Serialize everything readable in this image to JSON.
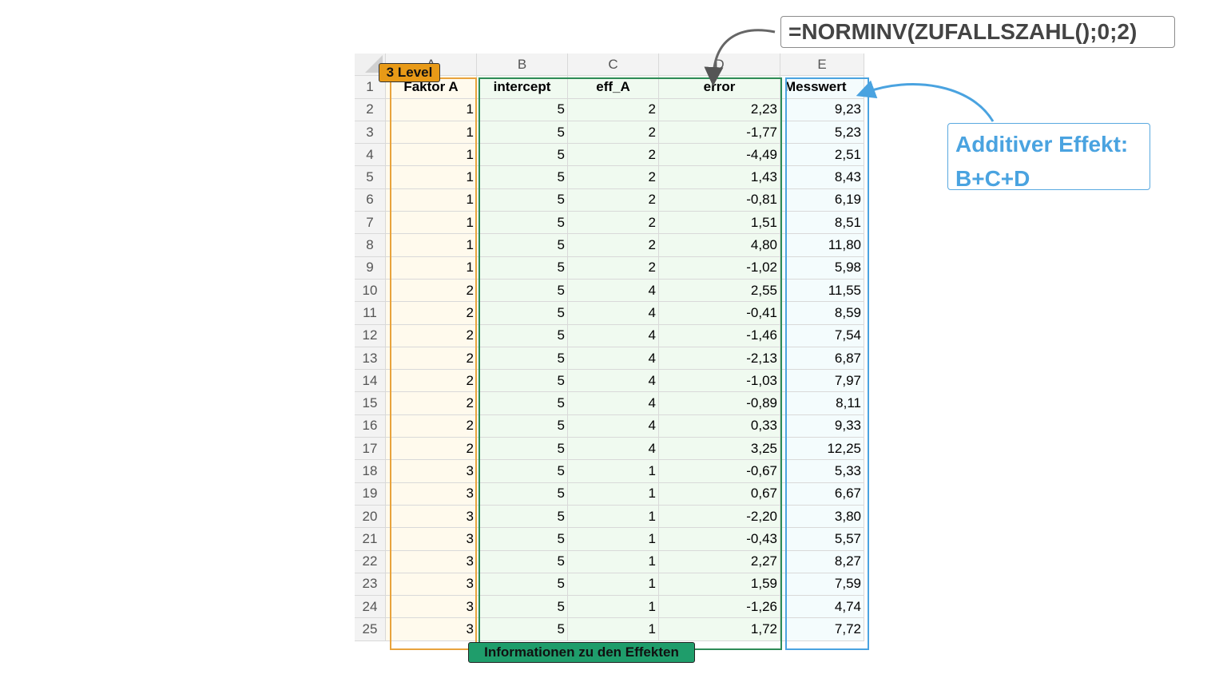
{
  "sheet": {
    "column_letters": [
      "A",
      "B",
      "C",
      "D",
      "E"
    ],
    "headers": [
      "Faktor A",
      "intercept",
      "eff_A",
      "error",
      "Messwert"
    ],
    "rows": [
      {
        "n": "2",
        "a": "1",
        "b": "5",
        "c": "2",
        "d": "2,23",
        "e": "9,23"
      },
      {
        "n": "3",
        "a": "1",
        "b": "5",
        "c": "2",
        "d": "-1,77",
        "e": "5,23"
      },
      {
        "n": "4",
        "a": "1",
        "b": "5",
        "c": "2",
        "d": "-4,49",
        "e": "2,51"
      },
      {
        "n": "5",
        "a": "1",
        "b": "5",
        "c": "2",
        "d": "1,43",
        "e": "8,43"
      },
      {
        "n": "6",
        "a": "1",
        "b": "5",
        "c": "2",
        "d": "-0,81",
        "e": "6,19"
      },
      {
        "n": "7",
        "a": "1",
        "b": "5",
        "c": "2",
        "d": "1,51",
        "e": "8,51"
      },
      {
        "n": "8",
        "a": "1",
        "b": "5",
        "c": "2",
        "d": "4,80",
        "e": "11,80"
      },
      {
        "n": "9",
        "a": "1",
        "b": "5",
        "c": "2",
        "d": "-1,02",
        "e": "5,98"
      },
      {
        "n": "10",
        "a": "2",
        "b": "5",
        "c": "4",
        "d": "2,55",
        "e": "11,55"
      },
      {
        "n": "11",
        "a": "2",
        "b": "5",
        "c": "4",
        "d": "-0,41",
        "e": "8,59"
      },
      {
        "n": "12",
        "a": "2",
        "b": "5",
        "c": "4",
        "d": "-1,46",
        "e": "7,54"
      },
      {
        "n": "13",
        "a": "2",
        "b": "5",
        "c": "4",
        "d": "-2,13",
        "e": "6,87"
      },
      {
        "n": "14",
        "a": "2",
        "b": "5",
        "c": "4",
        "d": "-1,03",
        "e": "7,97"
      },
      {
        "n": "15",
        "a": "2",
        "b": "5",
        "c": "4",
        "d": "-0,89",
        "e": "8,11"
      },
      {
        "n": "16",
        "a": "2",
        "b": "5",
        "c": "4",
        "d": "0,33",
        "e": "9,33"
      },
      {
        "n": "17",
        "a": "2",
        "b": "5",
        "c": "4",
        "d": "3,25",
        "e": "12,25"
      },
      {
        "n": "18",
        "a": "3",
        "b": "5",
        "c": "1",
        "d": "-0,67",
        "e": "5,33"
      },
      {
        "n": "19",
        "a": "3",
        "b": "5",
        "c": "1",
        "d": "0,67",
        "e": "6,67"
      },
      {
        "n": "20",
        "a": "3",
        "b": "5",
        "c": "1",
        "d": "-2,20",
        "e": "3,80"
      },
      {
        "n": "21",
        "a": "3",
        "b": "5",
        "c": "1",
        "d": "-0,43",
        "e": "5,57"
      },
      {
        "n": "22",
        "a": "3",
        "b": "5",
        "c": "1",
        "d": "2,27",
        "e": "8,27"
      },
      {
        "n": "23",
        "a": "3",
        "b": "5",
        "c": "1",
        "d": "1,59",
        "e": "7,59"
      },
      {
        "n": "24",
        "a": "3",
        "b": "5",
        "c": "1",
        "d": "-1,26",
        "e": "4,74"
      },
      {
        "n": "25",
        "a": "3",
        "b": "5",
        "c": "1",
        "d": "1,72",
        "e": "7,72"
      }
    ]
  },
  "annotations": {
    "level_badge": "3 Level",
    "effects_badge": "Informationen zu den Effekten",
    "formula": "=NORMINV(ZUFALLSZAHL();0;2)",
    "additive_title": "Additiver Effekt:",
    "additive_formula": "B+C+D"
  },
  "colors": {
    "factor_outline": "#e8a33d",
    "level_badge_fill": "#e89a17",
    "effects_outline": "#2e8b57",
    "effects_badge_fill": "#1f9d6b",
    "messwert_outline": "#4aa3e0",
    "formula_border": "#8c8c8c",
    "arrow_gray": "#666666"
  }
}
